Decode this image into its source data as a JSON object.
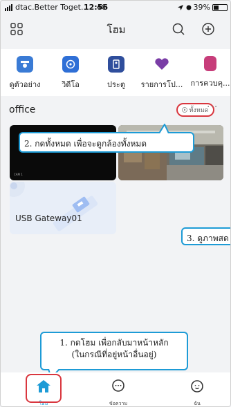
{
  "status_bar": {
    "carrier": "dtac.Better Toget...",
    "network": "4G",
    "time": "12:56",
    "battery": "39%"
  },
  "header": {
    "title": "โฮม",
    "left_icon": "grid-icon",
    "right_icons": [
      "search-icon",
      "add-icon"
    ]
  },
  "shortcuts": [
    {
      "label": "ดูตัวอย่าง",
      "icon": "camera-icon",
      "color": "#3a7bd5"
    },
    {
      "label": "วิดีโอ",
      "icon": "film-icon",
      "color": "#2f6fd6"
    },
    {
      "label": "ประตู",
      "icon": "door-icon",
      "color": "#2f4e9c"
    },
    {
      "label": "รายการโป...",
      "icon": "heart-icon",
      "color": "#7a3da6"
    },
    {
      "label": "การควบคุ...",
      "icon": "control-icon",
      "color": "#c73d7a"
    }
  ],
  "section": {
    "title": "office",
    "view_all": "ทั้งหมด",
    "more": "···"
  },
  "devices": {
    "cam1_label": "CAM 1",
    "gateway_name": "USB Gateway01"
  },
  "callouts": {
    "c1_line1": "1. กดโฮม เพื่อกลับมาหน้าหลัก",
    "c1_line2": "(ในกรณีที่อยู่หน้าอื่นอยู่)",
    "c2": "2. กดทั้งหมด เพื่อจะดูกล้องทั้งหมด",
    "c3": "3. ดูภาพสด"
  },
  "bottom_nav": [
    {
      "label": "โฮม",
      "icon": "home-icon",
      "active": true
    },
    {
      "label": "ข้อความ",
      "icon": "message-icon",
      "active": false
    },
    {
      "label": "ฉัน",
      "icon": "profile-icon",
      "active": false
    }
  ],
  "colors": {
    "accent": "#1d9bd6",
    "highlight": "#d9363e"
  }
}
